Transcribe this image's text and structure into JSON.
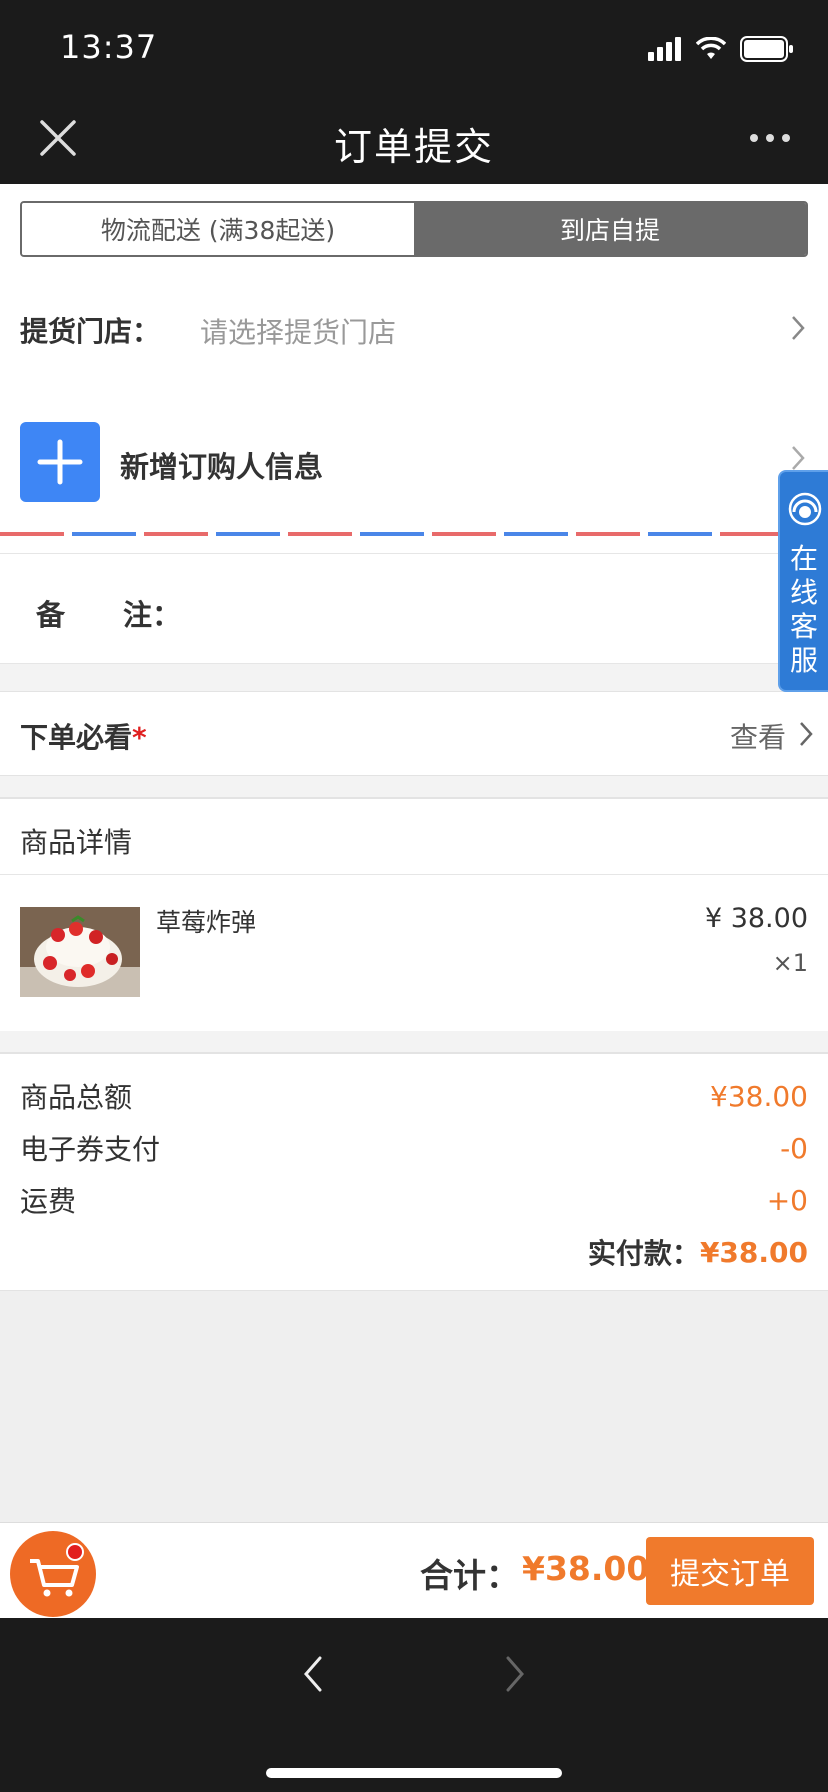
{
  "status_bar": {
    "time": "13:37"
  },
  "nav": {
    "title": "订单提交"
  },
  "delivery_tabs": [
    {
      "label": "物流配送 (满38起送)",
      "active": false
    },
    {
      "label": "到店自提",
      "active": true
    }
  ],
  "pickup": {
    "label": "提货门店：",
    "placeholder": "请选择提货门店"
  },
  "buyer": {
    "label": "新增订购人信息"
  },
  "note": {
    "label": "备　　注："
  },
  "must_read": {
    "label": "下单必看",
    "required_mark": "*",
    "action": "查看"
  },
  "goods": {
    "title": "商品详情",
    "items": [
      {
        "name": "草莓炸弹",
        "price": "¥ 38.00",
        "qty": "×1"
      }
    ]
  },
  "summary": {
    "rows": [
      {
        "label": "商品总额",
        "value": "¥38.00"
      },
      {
        "label": "电子券支付",
        "value": "-0"
      },
      {
        "label": "运费",
        "value": "+0"
      }
    ],
    "paid_label": "实付款：",
    "paid_value": "¥38.00"
  },
  "customer_service": {
    "label": "在线客服"
  },
  "bottom_bar": {
    "total_label": "合计：",
    "total_value": "¥38.00",
    "submit_label": "提交订单"
  },
  "colors": {
    "accent": "#f07a2c",
    "primary_blue": "#3e86f5",
    "dark_bar": "#1b1b1b"
  }
}
